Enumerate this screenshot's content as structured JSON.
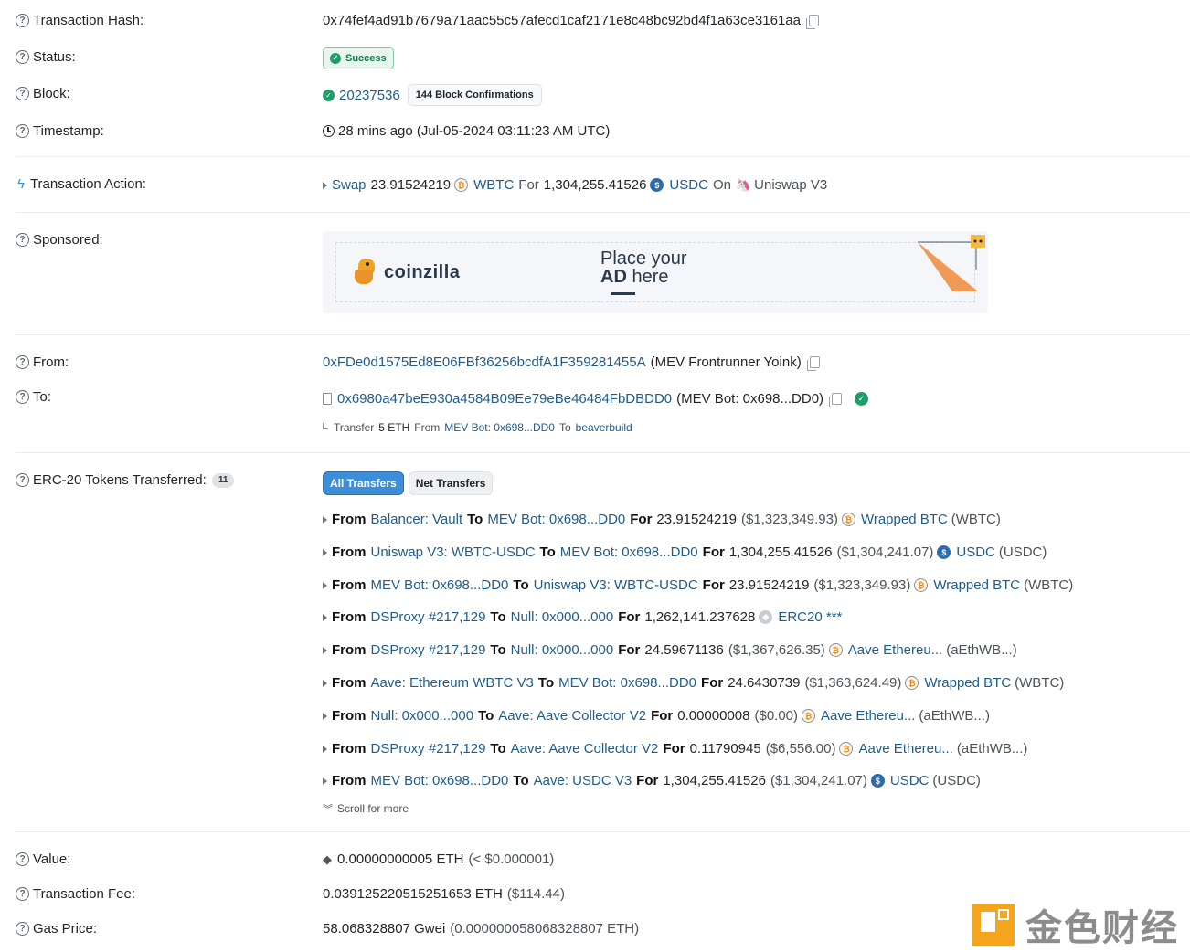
{
  "rows": {
    "tx_hash": {
      "label": "Transaction Hash:",
      "value": "0x74fef4ad91b7679a71aac55c57afecd1caf2171e8c48bc92bd4f1a63ce3161aa"
    },
    "status": {
      "label": "Status:",
      "value": "Success"
    },
    "block": {
      "label": "Block:",
      "value": "20237536",
      "confirmations": "144 Block Confirmations"
    },
    "timestamp": {
      "label": "Timestamp:",
      "value": "28 mins ago (Jul-05-2024 03:11:23 AM UTC)"
    },
    "action": {
      "label": "Transaction Action:",
      "verb": "Swap",
      "amount_in": "23.91524219",
      "token_in": "WBTC",
      "for": "For",
      "amount_out": "1,304,255.41526",
      "token_out": "USDC",
      "on": "On",
      "dex": "Uniswap V3"
    },
    "sponsored": {
      "label": "Sponsored:",
      "brand": "coinzilla",
      "line1": "Place your",
      "line2_bold": "AD",
      "line2_rest": " here"
    },
    "from": {
      "label": "From:",
      "address": "0xFDe0d1575Ed8E06FBf36256bcdfA1F359281455A",
      "name": "(MEV Frontrunner Yoink)"
    },
    "to": {
      "label": "To:",
      "address": "0x6980a47beE930a4584B09Ee79eBe46484FbDBDD0",
      "name": "(MEV Bot: 0x698...DD0)",
      "sub_transfer": "Transfer",
      "sub_amount": "5 ETH",
      "sub_from": "From",
      "sub_from_addr": "MEV Bot: 0x698...DD0",
      "sub_to": "To",
      "sub_to_addr": "beaverbuild"
    },
    "erc20": {
      "label": "ERC-20 Tokens Transferred:",
      "count": "11",
      "tab_all": "All Transfers",
      "tab_net": "Net Transfers",
      "scroll_more": "Scroll for more"
    },
    "value": {
      "label": "Value:",
      "amount": "0.00000000005 ETH",
      "usd": "(< $0.000001)"
    },
    "fee": {
      "label": "Transaction Fee:",
      "amount": "0.039125220515251653 ETH",
      "usd": "($114.44)"
    },
    "gas": {
      "label": "Gas Price:",
      "amount": "58.068328807 Gwei",
      "eth": "(0.000000058068328807 ETH)"
    }
  },
  "transfers": [
    {
      "from_kw": "From",
      "from": "Balancer: Vault",
      "to_kw": "To",
      "to": "MEV Bot: 0x698...DD0",
      "for_kw": "For",
      "amount": "23.91524219",
      "usd": "($1,323,349.93)",
      "icon": "btc",
      "token": "Wrapped BTC",
      "symbol": "(WBTC)"
    },
    {
      "from_kw": "From",
      "from": "Uniswap V3: WBTC-USDC",
      "to_kw": "To",
      "to": "MEV Bot: 0x698...DD0",
      "for_kw": "For",
      "amount": "1,304,255.41526",
      "usd": "($1,304,241.07)",
      "icon": "usdc",
      "token": "USDC",
      "symbol": "(USDC)"
    },
    {
      "from_kw": "From",
      "from": "MEV Bot: 0x698...DD0",
      "to_kw": "To",
      "to": "Uniswap V3: WBTC-USDC",
      "for_kw": "For",
      "amount": "23.91524219",
      "usd": "($1,323,349.93)",
      "icon": "btc",
      "token": "Wrapped BTC",
      "symbol": "(WBTC)"
    },
    {
      "from_kw": "From",
      "from": "DSProxy #217,129",
      "to_kw": "To",
      "to": "Null: 0x000...000",
      "for_kw": "For",
      "amount": "1,262,141.237628",
      "usd": "",
      "icon": "erc",
      "token": "ERC20 ***",
      "symbol": ""
    },
    {
      "from_kw": "From",
      "from": "DSProxy #217,129",
      "to_kw": "To",
      "to": "Null: 0x000...000",
      "for_kw": "For",
      "amount": "24.59671136",
      "usd": "($1,367,626.35)",
      "icon": "btc",
      "token": "Aave Ethereu...",
      "symbol": "(aEthWB...)"
    },
    {
      "from_kw": "From",
      "from": "Aave: Ethereum WBTC V3",
      "to_kw": "To",
      "to": "MEV Bot: 0x698...DD0",
      "for_kw": "For",
      "amount": "24.6430739",
      "usd": "($1,363,624.49)",
      "icon": "btc",
      "token": "Wrapped BTC",
      "symbol": "(WBTC)"
    },
    {
      "from_kw": "From",
      "from": "Null: 0x000...000",
      "to_kw": "To",
      "to": "Aave: Aave Collector V2",
      "for_kw": "For",
      "amount": "0.00000008",
      "usd": "($0.00)",
      "icon": "btc",
      "token": "Aave Ethereu...",
      "symbol": "(aEthWB...)"
    },
    {
      "from_kw": "From",
      "from": "DSProxy #217,129",
      "to_kw": "To",
      "to": "Aave: Aave Collector V2",
      "for_kw": "For",
      "amount": "0.11790945",
      "usd": "($6,556.00)",
      "icon": "btc",
      "token": "Aave Ethereu...",
      "symbol": "(aEthWB...)"
    },
    {
      "from_kw": "From",
      "from": "MEV Bot: 0x698...DD0",
      "to_kw": "To",
      "to": "Aave: USDC V3",
      "for_kw": "For",
      "amount": "1,304,255.41526",
      "usd": "($1,304,241.07)",
      "icon": "usdc",
      "token": "USDC",
      "symbol": "(USDC)"
    }
  ],
  "watermark": {
    "text": "金色财经"
  },
  "colors": {
    "link": "#1f5c8a",
    "success": "#0f7a4b",
    "active_tab": "#3d8ed8"
  }
}
